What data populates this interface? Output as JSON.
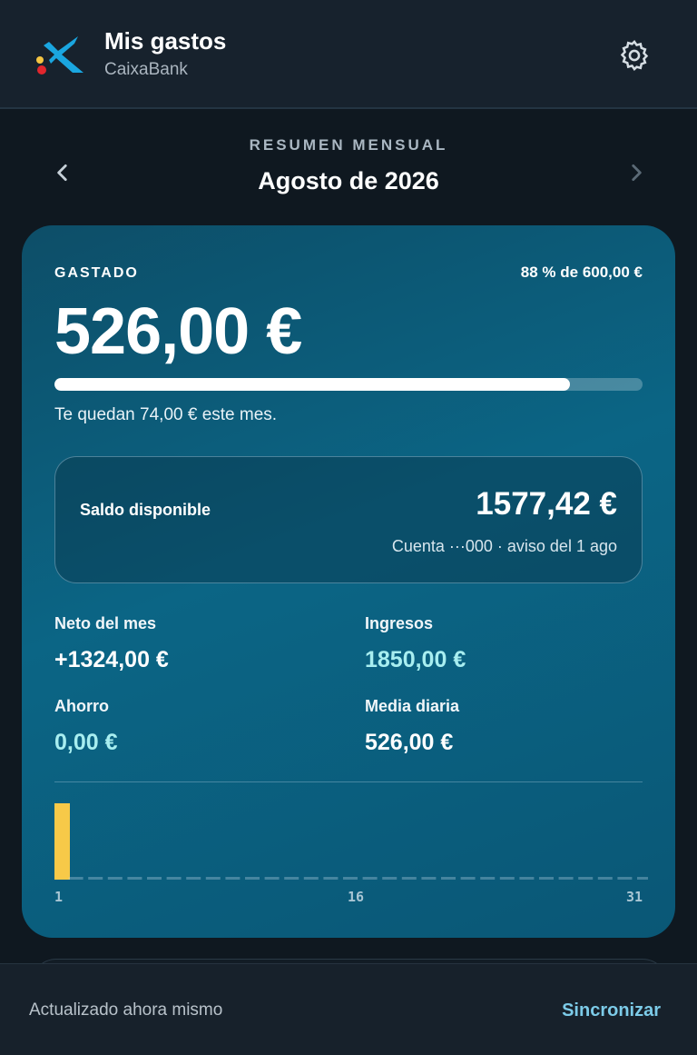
{
  "header": {
    "title": "Mis gastos",
    "subtitle": "CaixaBank",
    "logo": "caixabank-star-logo",
    "settings_icon": "gear-icon"
  },
  "month_nav": {
    "section_label": "RESUMEN MENSUAL",
    "month": "Agosto de 2026",
    "prev_icon": "chevron-left-icon",
    "next_icon": "chevron-right-icon"
  },
  "summary": {
    "spent_label": "GASTADO",
    "budget_text": "88 % de 600,00 €",
    "spent_amount": "526,00 €",
    "progress_fraction": 0.8767,
    "remaining_text": "Te quedan 74,00 € este mes."
  },
  "balance": {
    "label": "Saldo disponible",
    "amount": "1577,42 €",
    "detail": "Cuenta ···000 · aviso del 1 ago"
  },
  "stats": [
    {
      "label": "Neto del mes",
      "value": "+1324,00 €",
      "color": "#ffffff"
    },
    {
      "label": "Ingresos",
      "value": "1850,00 €",
      "color": "#a8eef0"
    },
    {
      "label": "Ahorro",
      "value": "0,00 €",
      "color": "#a8eef0"
    },
    {
      "label": "Media diaria",
      "value": "526,00 €",
      "color": "#ffffff"
    }
  ],
  "chart_data": {
    "type": "bar",
    "x": [
      1,
      2,
      3,
      4,
      5,
      6,
      7,
      8,
      9,
      10,
      11,
      12,
      13,
      14,
      15,
      16,
      17,
      18,
      19,
      20,
      21,
      22,
      23,
      24,
      25,
      26,
      27,
      28,
      29,
      30,
      31
    ],
    "values": [
      526,
      0,
      0,
      0,
      0,
      0,
      0,
      0,
      0,
      0,
      0,
      0,
      0,
      0,
      0,
      0,
      0,
      0,
      0,
      0,
      0,
      0,
      0,
      0,
      0,
      0,
      0,
      0,
      0,
      0,
      0
    ],
    "tick_labels": [
      "1",
      "16",
      "31"
    ],
    "bar_color": "#f7c948"
  },
  "footer": {
    "status": "Actualizado ahora mismo",
    "sync_label": "Sincronizar"
  },
  "colors": {
    "background": "#0f1820",
    "accent": "#7ccbe8",
    "card": "#0b6585"
  }
}
